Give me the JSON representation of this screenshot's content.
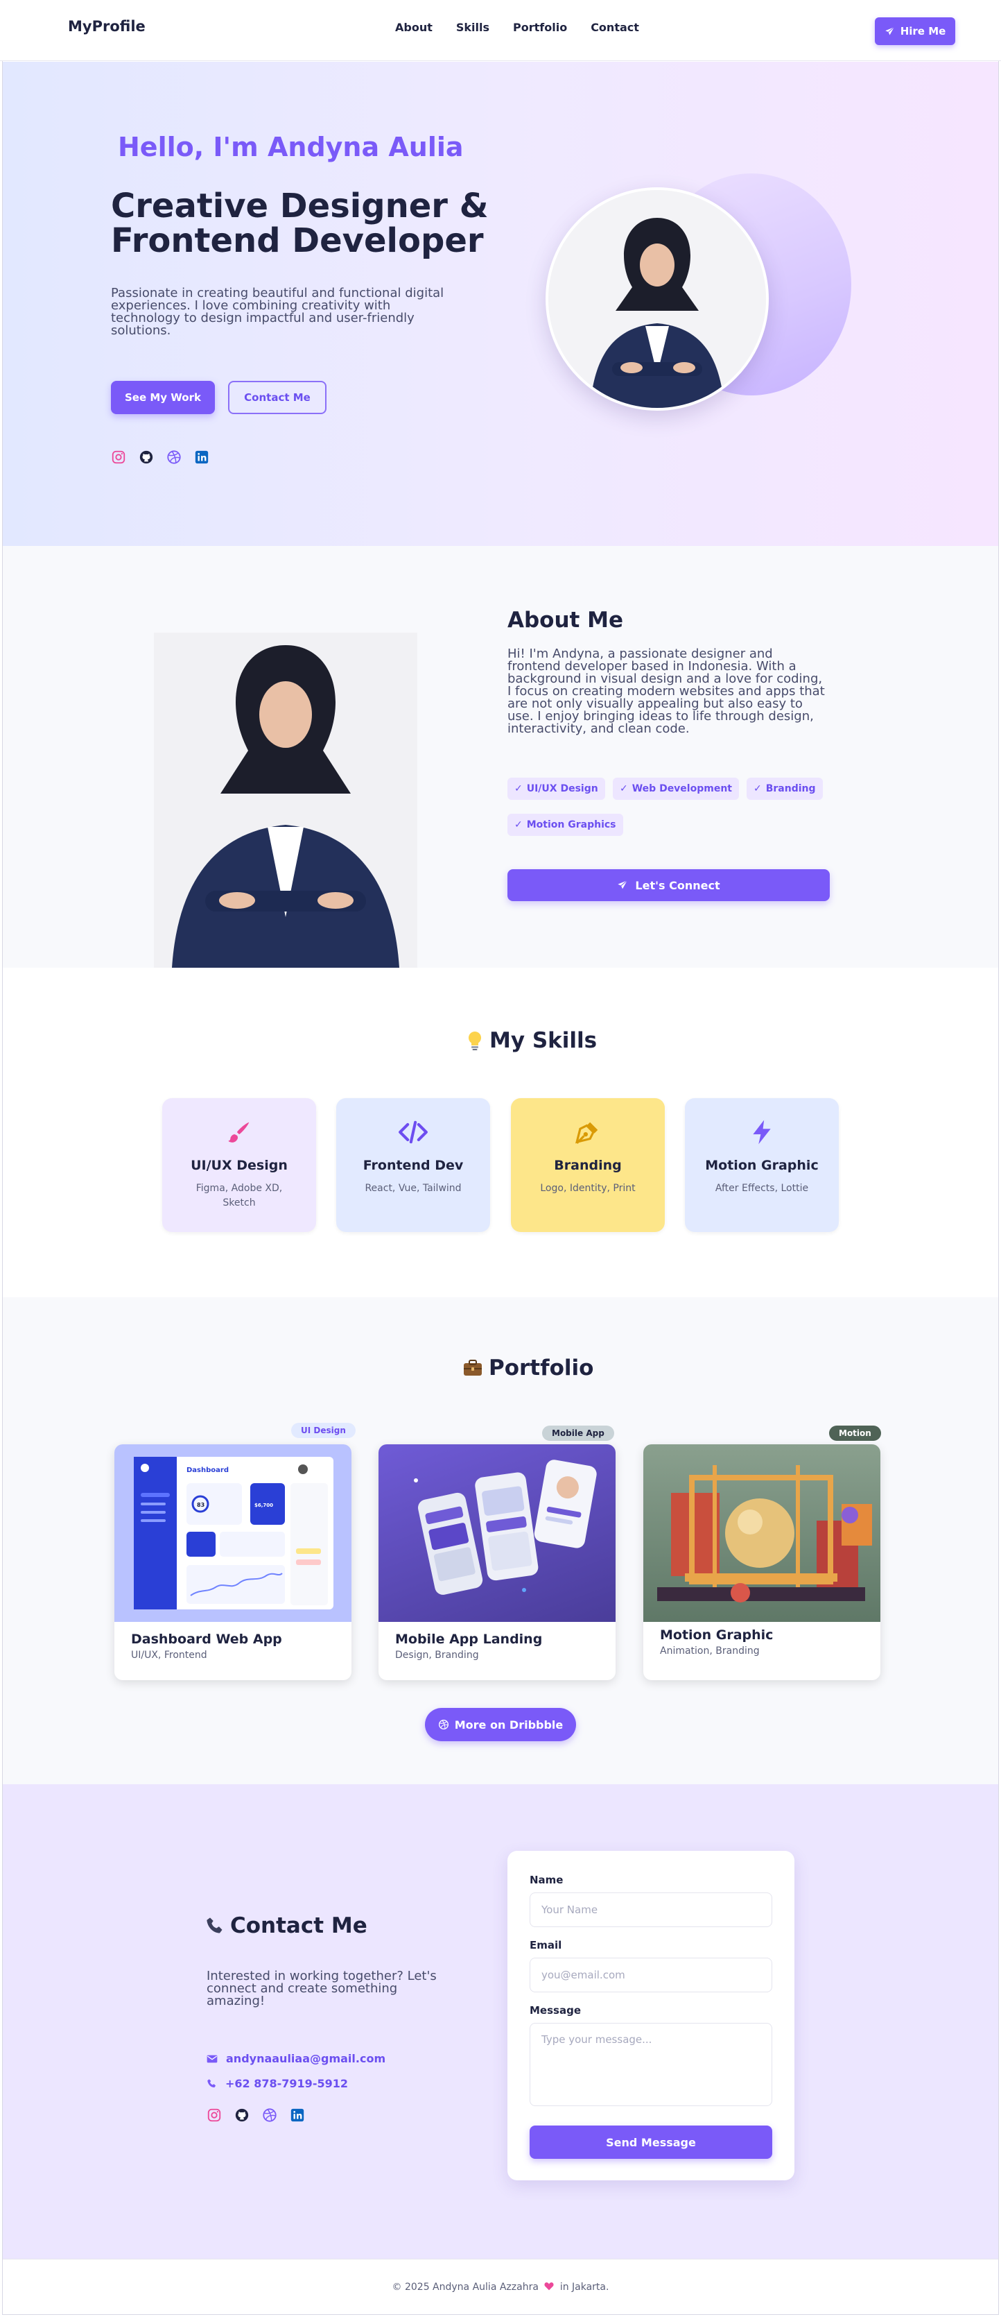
{
  "nav": {
    "brand": "MyProfile",
    "links": [
      "About",
      "Skills",
      "Portfolio",
      "Contact"
    ],
    "hire_label": "Hire Me"
  },
  "hero": {
    "greeting": "Hello, I'm Andyna Aulia",
    "headline_line1": "Creative Designer &",
    "headline_line2": "Frontend Developer",
    "description": "Passionate in creating beautiful and functional digital experiences. I love combining creativity with technology to design impactful and user-friendly solutions.",
    "primary_button": "See My Work",
    "secondary_button": "Contact Me",
    "social_icons": [
      "instagram-icon",
      "github-icon",
      "dribbble-icon",
      "linkedin-icon"
    ]
  },
  "about": {
    "title": "About Me",
    "text": "Hi! I'm Andyna, a passionate designer and frontend developer based in Indonesia. With a background in visual design and a love for coding, I focus on creating modern websites and apps that are not only visually appealing but also easy to use. I enjoy bringing ideas to life through design, interactivity, and clean code.",
    "tags": [
      "UI/UX Design",
      "Web Development",
      "Branding",
      "Motion Graphics"
    ],
    "cta": "Let's Connect"
  },
  "skills": {
    "title": "My Skills",
    "items": [
      {
        "title": "UI/UX Design",
        "desc": "Figma, Adobe XD, Sketch",
        "icon": "brush-icon",
        "bg": "#efe8ff",
        "color": "#ec4899"
      },
      {
        "title": "Frontend Dev",
        "desc": "React, Vue, Tailwind",
        "icon": "code-icon",
        "bg": "#e2eaff",
        "color": "#6d4df0"
      },
      {
        "title": "Branding",
        "desc": "Logo, Identity, Print",
        "icon": "pen-nib-icon",
        "bg": "#fde68a",
        "color": "#d99a06"
      },
      {
        "title": "Motion Graphic",
        "desc": "After Effects, Lottie",
        "icon": "bolt-icon",
        "bg": "#e2eaff",
        "color": "#7a5af8"
      }
    ]
  },
  "portfolio": {
    "title": "Portfolio",
    "items": [
      {
        "title": "Dashboard Web App",
        "desc": "UI/UX, Frontend",
        "badge": "UI Design"
      },
      {
        "title": "Mobile App Landing",
        "desc": "Design, Branding",
        "badge": "Mobile App"
      },
      {
        "title": "Motion Graphic",
        "desc": "Animation, Branding",
        "badge": "Motion"
      }
    ],
    "more_label": "More on Dribbble",
    "mock": {
      "dashboard_title": "Dashboard",
      "stat_a": "83",
      "stat_b": "$6,700"
    }
  },
  "contact": {
    "title": "Contact Me",
    "text": "Interested in working together? Let's connect and create something amazing!",
    "email": "andynaauliaa@gmail.com",
    "phone": "+62 878-7919-5912",
    "form": {
      "name_label": "Name",
      "name_placeholder": "Your Name",
      "email_label": "Email",
      "email_placeholder": "you@email.com",
      "message_label": "Message",
      "message_placeholder": "Type your message...",
      "submit": "Send Message"
    }
  },
  "footer": {
    "before_heart": "© 2025 Andyna Aulia Azzahra",
    "after_heart": "in Jakarta."
  },
  "colors": {
    "accent": "#7a5af8",
    "dark": "#1f2340",
    "muted": "#474b6a",
    "heart": "#ec4899"
  }
}
